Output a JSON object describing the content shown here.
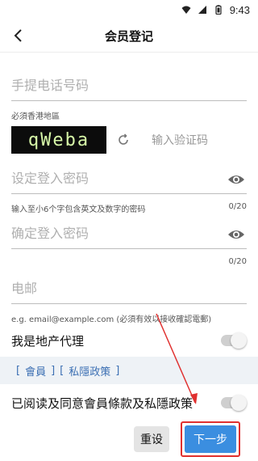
{
  "status_bar": {
    "time": "9:43"
  },
  "header": {
    "title": "会员登记"
  },
  "form": {
    "phone_placeholder": "手提电话号码",
    "phone_hint": "必須香港地區",
    "captcha_text": "qWeba",
    "captcha_input_placeholder": "输入验证码",
    "password_placeholder": "设定登入密码",
    "password_hint": "输入至小6个字包含英文及数字的密码",
    "password_counter": "0/20",
    "confirm_placeholder": "确定登入密码",
    "confirm_counter": "0/20",
    "email_placeholder": "电邮",
    "email_hint": "e.g. email@example.com (必須有效以接收確認電郵)",
    "agent_label": "我是地产代理"
  },
  "links": {
    "open1": "[",
    "member": "會員",
    "close1": "]",
    "open2": "[",
    "privacy": "私隱政策",
    "close2": "]"
  },
  "agree_label": "已阅读及同意會員條款及私隱政策",
  "buttons": {
    "reset": "重设",
    "next": "下一步"
  },
  "colors": {
    "primary": "#3b8ee0",
    "annotation": "#e0302f",
    "link": "#3b6fb3"
  },
  "icons": [
    "wifi-icon",
    "signal-icon",
    "battery-icon",
    "back-arrow-icon",
    "refresh-icon",
    "eye-icon"
  ]
}
